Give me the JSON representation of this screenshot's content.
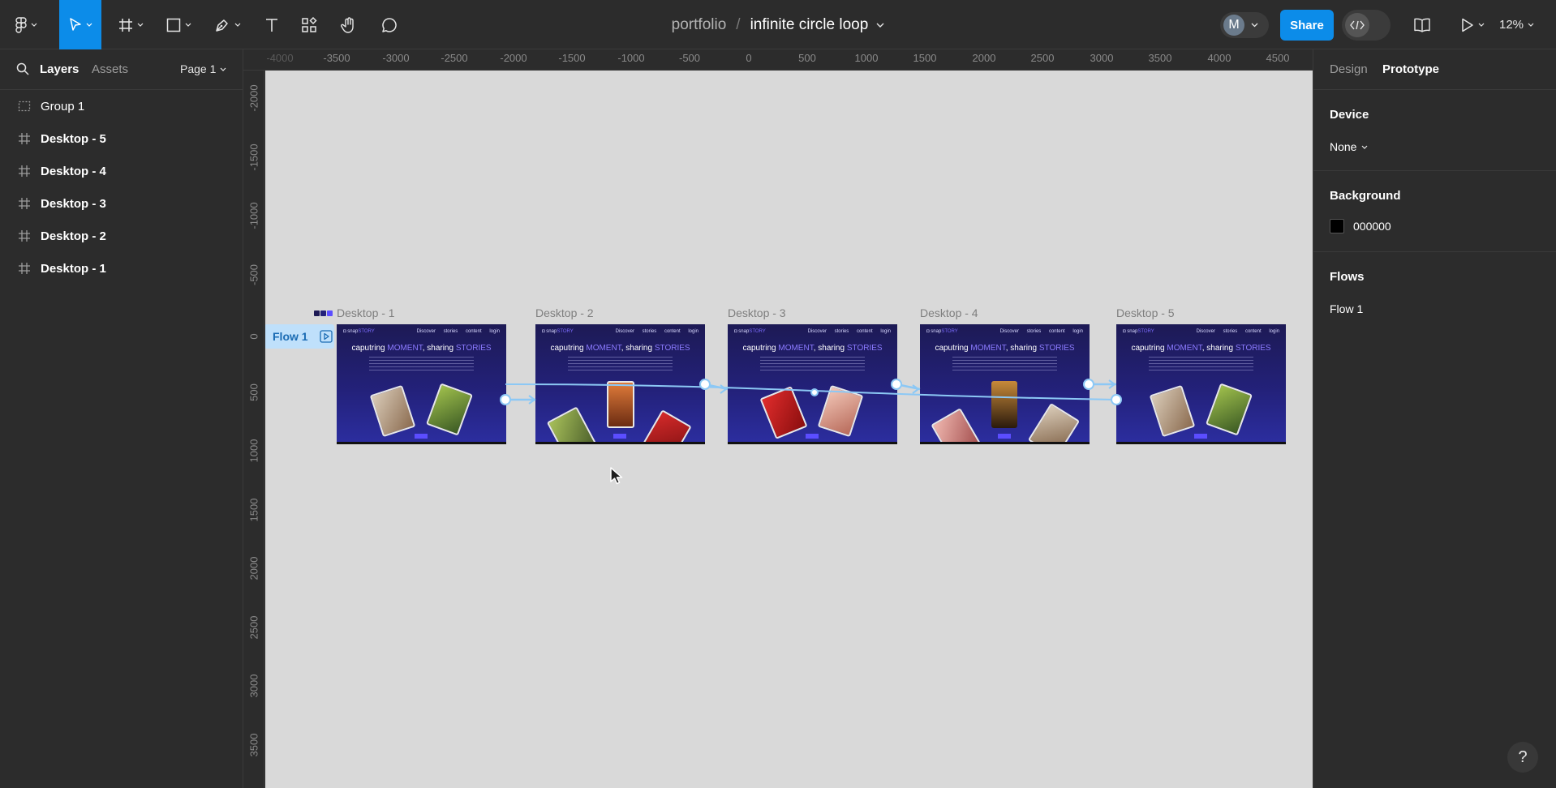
{
  "toolbar": {
    "file_project": "portfolio",
    "file_separator": "/",
    "file_name": "infinite circle loop",
    "avatar_initial": "M",
    "share_label": "Share",
    "zoom_level": "12%",
    "active_tool": "move"
  },
  "left_panel": {
    "tab_layers": "Layers",
    "tab_assets": "Assets",
    "page_name": "Page 1",
    "layers": [
      {
        "name": "Group 1",
        "type": "group"
      },
      {
        "name": "Desktop - 5",
        "type": "frame"
      },
      {
        "name": "Desktop - 4",
        "type": "frame"
      },
      {
        "name": "Desktop - 3",
        "type": "frame"
      },
      {
        "name": "Desktop - 2",
        "type": "frame"
      },
      {
        "name": "Desktop - 1",
        "type": "frame"
      }
    ]
  },
  "rulers": {
    "horizontal": [
      "-4000",
      "-3500",
      "-3000",
      "-2500",
      "-2000",
      "-1500",
      "-1000",
      "-500",
      "0",
      "500",
      "1000",
      "1500",
      "2000",
      "2500",
      "3000",
      "3500",
      "4000",
      "4500"
    ],
    "vertical": [
      "-2000",
      "-1500",
      "-1000",
      "-500",
      "0",
      "500",
      "1000",
      "1500",
      "2000",
      "2500",
      "3000",
      "3500"
    ]
  },
  "canvas": {
    "background": "#d9d9d9",
    "flow_badge": "Flow 1",
    "frames": [
      {
        "label": "Desktop - 1"
      },
      {
        "label": "Desktop - 2"
      },
      {
        "label": "Desktop - 3"
      },
      {
        "label": "Desktop - 4"
      },
      {
        "label": "Desktop - 5"
      }
    ],
    "frame_content": {
      "logo_plain": "snap",
      "logo_accent": "STORY",
      "nav_links": "Discover stories content login",
      "heading_1": "caputring ",
      "heading_2": "MOMENT",
      "heading_3": ", sharing ",
      "heading_4": "STORIES"
    },
    "accent_color": "#0c8ce9",
    "connector_color": "#8cc8f5"
  },
  "right_panel": {
    "tab_design": "Design",
    "tab_prototype": "Prototype",
    "device_heading": "Device",
    "device_value": "None",
    "background_heading": "Background",
    "background_value": "000000",
    "flows_heading": "Flows",
    "flows": [
      "Flow 1"
    ]
  },
  "help_label": "?"
}
